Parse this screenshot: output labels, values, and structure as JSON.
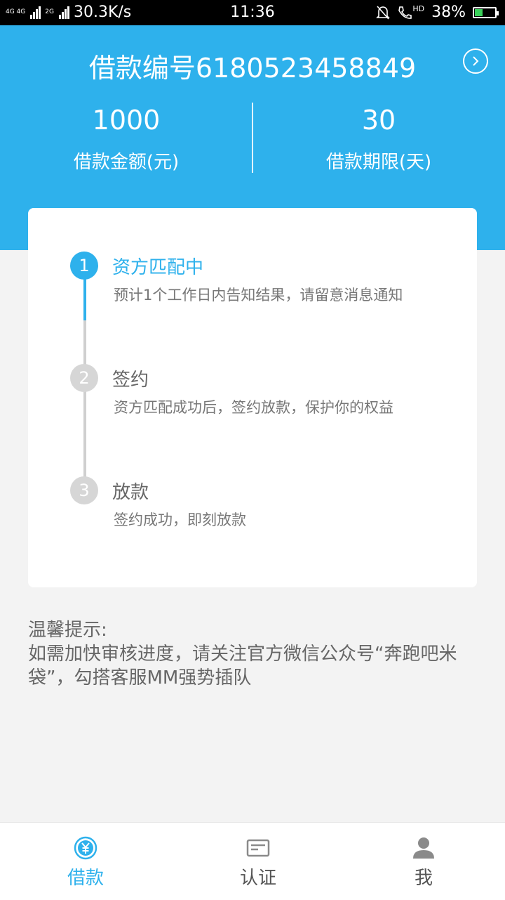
{
  "status_bar": {
    "net_label_1": "4G 4G",
    "net_label_2": "2G",
    "speed": "30.3K/s",
    "time": "11:36",
    "hd": "HD",
    "battery": "38%",
    "battery_level": 0.38,
    "icons": [
      "signal-icon",
      "mute-bell-icon",
      "phone-hd-icon",
      "battery-charging-icon"
    ]
  },
  "header": {
    "loan_number": "借款编号6180523458849",
    "amount_value": "1000",
    "amount_label": "借款金额(元)",
    "term_value": "30",
    "term_label": "借款期限(天)",
    "next_icon": "chevron-right-circle-icon"
  },
  "steps": [
    {
      "num": "1",
      "title": "资方匹配中",
      "desc": "预计1个工作日内告知结果，请留意消息通知",
      "active": true
    },
    {
      "num": "2",
      "title": "签约",
      "desc": "资方匹配成功后，签约放款，保护你的权益",
      "active": false
    },
    {
      "num": "3",
      "title": "放款",
      "desc": "签约成功，即刻放款",
      "active": false
    }
  ],
  "tips": {
    "title": "温馨提示:",
    "body": "如需加快审核进度，请关注官方微信公众号“奔跑吧米袋”，勾搭客服MM强势插队"
  },
  "tabs": [
    {
      "label": "借款",
      "icon": "yuan-coin-icon",
      "active": true
    },
    {
      "label": "认证",
      "icon": "id-card-icon",
      "active": false
    },
    {
      "label": "我",
      "icon": "user-icon",
      "active": false
    }
  ],
  "colors": {
    "accent": "#2eb1ec",
    "inactive": "#d6d6d6",
    "background": "#f3f3f3"
  }
}
